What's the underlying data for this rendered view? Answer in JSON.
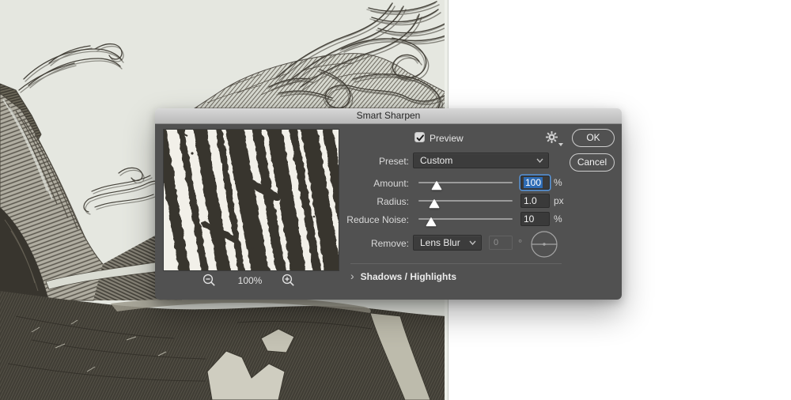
{
  "window": {
    "title": "Smart Sharpen"
  },
  "buttons": {
    "ok": "OK",
    "cancel": "Cancel"
  },
  "preview_panel": {
    "zoom_level": "100%"
  },
  "controls": {
    "preview_checkbox": {
      "label": "Preview",
      "checked": true
    },
    "preset": {
      "label": "Preset:",
      "value": "Custom"
    },
    "amount": {
      "label": "Amount:",
      "value": "100",
      "unit": "%",
      "selected": true
    },
    "radius": {
      "label": "Radius:",
      "value": "1.0",
      "unit": "px"
    },
    "reduce_noise": {
      "label": "Reduce Noise:",
      "value": "10",
      "unit": "%"
    },
    "remove": {
      "label": "Remove:",
      "value": "Lens Blur",
      "angle_value": "0",
      "angle_unit": "°",
      "angle_enabled": false
    },
    "shadows_highlights": {
      "chevron": "›",
      "label": "Shadows / Highlights",
      "expanded": false
    }
  },
  "icons": {
    "settings": "gear",
    "zoom_out": "magnifier-minus",
    "zoom_in": "magnifier-plus",
    "preset_dropdown": "chevron-down",
    "remove_dropdown": "chevron-down",
    "disclosure": "chevron-right",
    "angle_dial": "dial"
  },
  "colors": {
    "dialog_bg": "#515151",
    "titlebar_top": "#d8d8d8",
    "titlebar_bottom": "#b9b9b9",
    "selection_blue": "#2e6cb5",
    "focus_ring": "#5596e0",
    "paper": "#e5e7e0",
    "ink": "#4a463d",
    "canvas_right": "#ffffff"
  }
}
